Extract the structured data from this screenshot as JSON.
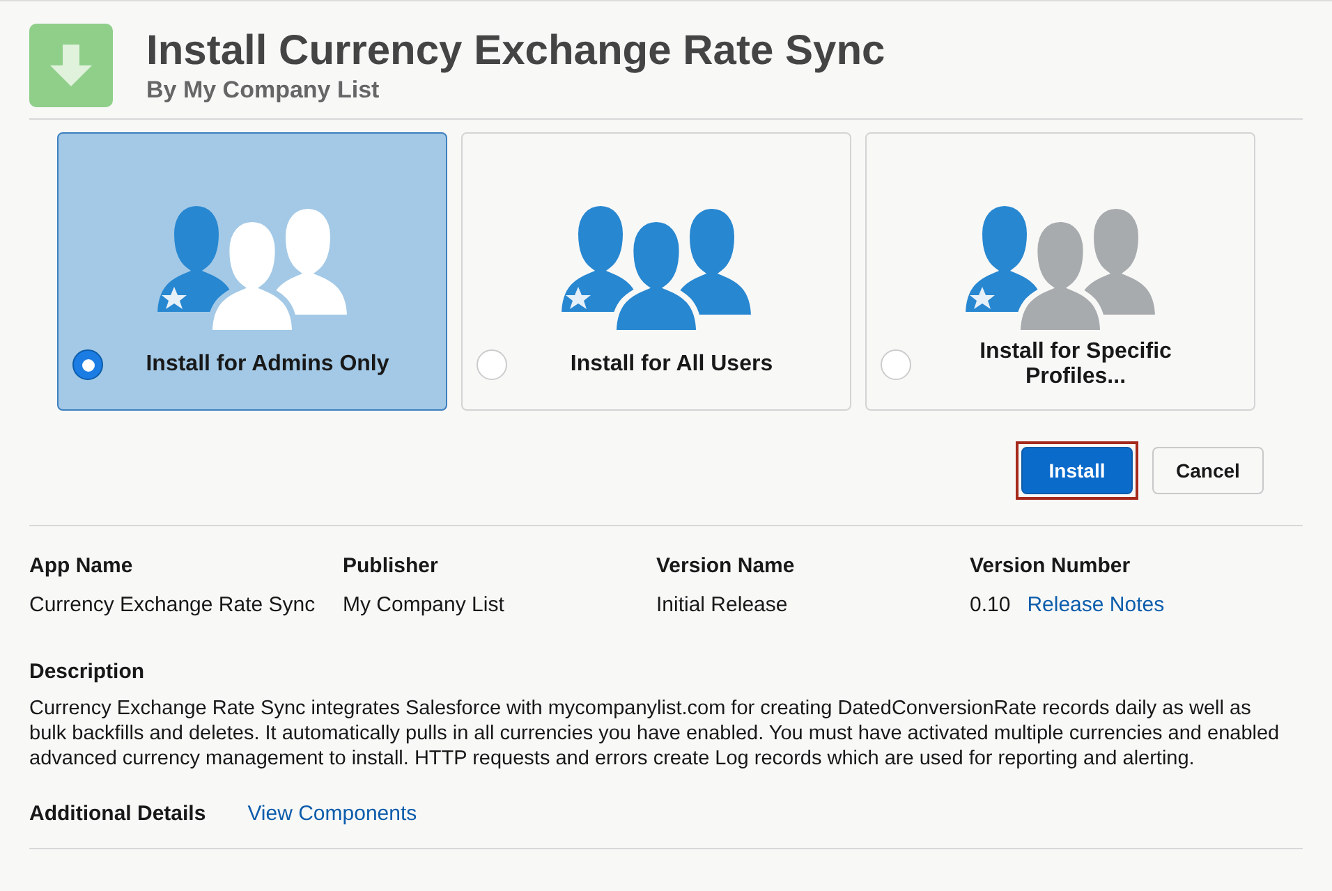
{
  "header": {
    "title": "Install Currency Exchange Rate Sync",
    "subtitle": "By My Company List"
  },
  "options": [
    {
      "label": "Install for Admins Only",
      "kind": "admins",
      "selected": true
    },
    {
      "label": "Install for All Users",
      "kind": "all",
      "selected": false
    },
    {
      "label": "Install for Specific Profiles...",
      "kind": "profiles",
      "selected": false
    }
  ],
  "buttons": [
    {
      "label": "Install",
      "kind": "primary",
      "focused": true
    },
    {
      "label": "Cancel",
      "kind": "neutral",
      "focused": false
    }
  ],
  "details": [
    {
      "label": "App Name",
      "value": "Currency Exchange Rate Sync"
    },
    {
      "label": "Publisher",
      "value": "My Company List"
    },
    {
      "label": "Version Name",
      "value": "Initial Release"
    },
    {
      "label": "Version Number",
      "value": "0.10",
      "link": "Release Notes"
    }
  ],
  "description": {
    "label": "Description",
    "text": "Currency Exchange Rate Sync integrates Salesforce with mycompanylist.com for creating DatedConversionRate records daily as well as bulk backfills and deletes. It automatically pulls in all currencies you have enabled. You must have activated multiple currencies and enabled advanced currency management to install. HTTP requests and errors create Log records which are used for reporting and alerting."
  },
  "additional_details": {
    "label": "Additional Details",
    "link": "View Components"
  }
}
